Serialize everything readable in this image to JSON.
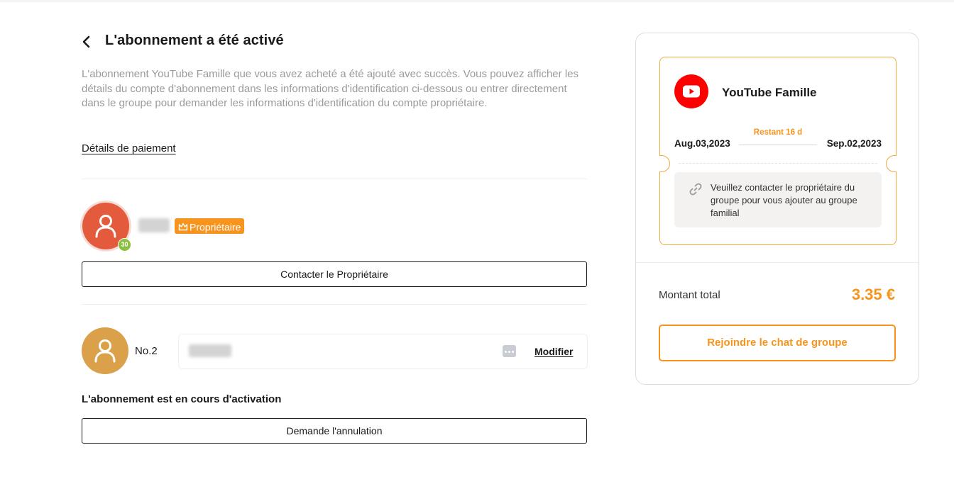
{
  "page": {
    "title": "L'abonnement a été activé",
    "description": "L'abonnement YouTube Famille que vous avez acheté a été ajouté avec succès. Vous pouvez afficher les détails du compte d'abonnement dans les informations d'identification ci-dessous ou entrer directement dans le groupe pour demander les informations d'identification du compte propriétaire.",
    "payment_details_link": "Détails de paiement"
  },
  "owner": {
    "level": "30",
    "badge_label": "Propriétaire",
    "contact_button": "Contacter le Propriétaire",
    "avatar_color": "#e45a3c",
    "badge_color": "#f7941d"
  },
  "member": {
    "number_label": "No.2",
    "modify_link": "Modifier",
    "status_text": "L'abonnement est en cours d'activation",
    "cancel_button": "Demande l'annulation",
    "avatar_color": "#dba14a"
  },
  "subscription": {
    "service_name": "YouTube Famille",
    "remaining": "Restant 16 d",
    "start_date": "Aug.03,2023",
    "end_date": "Sep.02,2023",
    "note": "Veuillez contacter le propriétaire du groupe pour vous ajouter au groupe familial",
    "brand_color": "#ff0000"
  },
  "summary": {
    "total_label": "Montant total",
    "total_value": "3.35 €",
    "join_button": "Rejoindre le chat de groupe",
    "accent_color": "#f7941d"
  },
  "icons": {
    "back": "chevron-left-icon",
    "user": "user-icon",
    "crown": "crown-icon",
    "play": "youtube-play-icon",
    "link": "link-icon",
    "more": "more-dots-icon"
  }
}
